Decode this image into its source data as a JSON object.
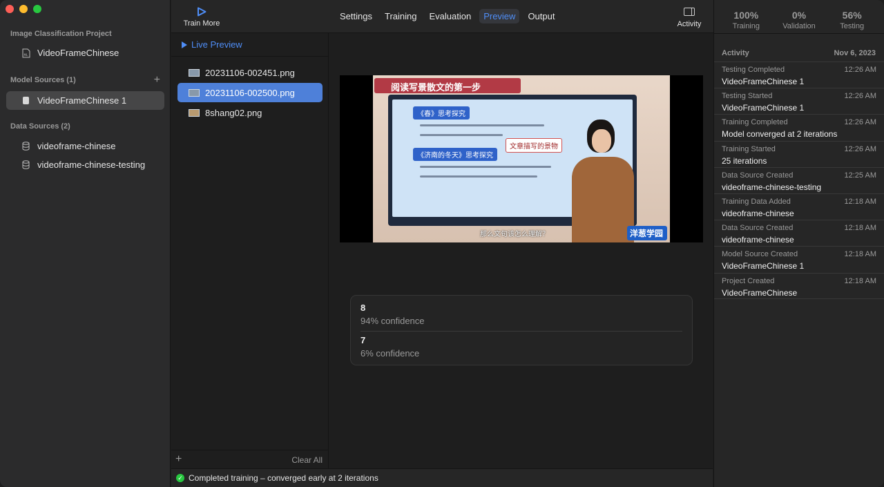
{
  "sidebar": {
    "project_label": "Image Classification Project",
    "project_name": "VideoFrameChinese",
    "model_sources_label": "Model Sources (1)",
    "model_sources": [
      "VideoFrameChinese 1"
    ],
    "data_sources_label": "Data Sources (2)",
    "data_sources": [
      "videoframe-chinese",
      "videoframe-chinese-testing"
    ]
  },
  "toolbar": {
    "train_more_label": "Train More",
    "tabs": [
      {
        "label": "Settings",
        "active": false
      },
      {
        "label": "Training",
        "active": false
      },
      {
        "label": "Evaluation",
        "active": false
      },
      {
        "label": "Preview",
        "active": true
      },
      {
        "label": "Output",
        "active": false
      }
    ],
    "activity_label": "Activity"
  },
  "files": {
    "live_preview_label": "Live Preview",
    "items": [
      {
        "name": "20231106-002451.png",
        "selected": false
      },
      {
        "name": "20231106-002500.png",
        "selected": true
      },
      {
        "name": "8shang02.png",
        "selected": false
      }
    ],
    "clear_all_label": "Clear All"
  },
  "preview": {
    "image": {
      "banner": "阅读写景散文的第一步",
      "chip1": "《春》思考探究",
      "chip2": "《济南的冬天》思考探究",
      "note": "文章描写的景物",
      "logo": "洋葱学园",
      "subtitle": "那么文句该怎么理解？"
    },
    "results": [
      {
        "label": "8",
        "confidence": "94% confidence"
      },
      {
        "label": "7",
        "confidence": "6% confidence"
      }
    ]
  },
  "status": {
    "message": "Completed training – converged early at 2 iterations",
    "color": "#28c840"
  },
  "activity_panel": {
    "stats": [
      {
        "value": "100%",
        "label": "Training"
      },
      {
        "value": "0%",
        "label": "Validation"
      },
      {
        "value": "56%",
        "label": "Testing"
      }
    ],
    "header": "Activity",
    "date": "Nov 6, 2023",
    "entries": [
      {
        "event": "Testing Completed",
        "time": "12:26 AM",
        "value": "VideoFrameChinese 1"
      },
      {
        "event": "Testing Started",
        "time": "12:26 AM",
        "value": "VideoFrameChinese 1"
      },
      {
        "event": "Training Completed",
        "time": "12:26 AM",
        "value": "Model converged at 2 iterations"
      },
      {
        "event": "Training Started",
        "time": "12:26 AM",
        "value": "25 iterations"
      },
      {
        "event": "Data Source Created",
        "time": "12:25 AM",
        "value": "videoframe-chinese-testing"
      },
      {
        "event": "Training Data Added",
        "time": "12:18 AM",
        "value": "videoframe-chinese"
      },
      {
        "event": "Data Source Created",
        "time": "12:18 AM",
        "value": "videoframe-chinese"
      },
      {
        "event": "Model Source Created",
        "time": "12:18 AM",
        "value": "VideoFrameChinese 1"
      },
      {
        "event": "Project Created",
        "time": "12:18 AM",
        "value": "VideoFrameChinese"
      }
    ]
  },
  "colors": {
    "accent": "#4f8ef7",
    "selection": "#4e80d9",
    "success": "#28c840"
  }
}
